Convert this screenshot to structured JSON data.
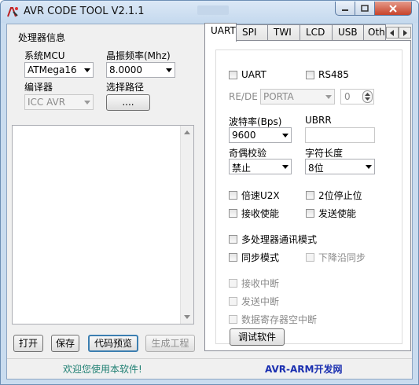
{
  "window": {
    "title": "AVR CODE TOOL V2.1.1"
  },
  "left": {
    "group_title": "处理器信息",
    "mcu": {
      "label": "系统MCU",
      "value": "ATMega16"
    },
    "freq": {
      "label": "晶振频率(Mhz)",
      "value": "8.0000"
    },
    "compiler": {
      "label": "编译器",
      "value": "ICC AVR"
    },
    "path": {
      "label": "选择路径",
      "button": "...."
    }
  },
  "buttons": {
    "open": "打开",
    "save": "保存",
    "preview": "代码预览",
    "generate": "生成工程"
  },
  "tabs": [
    "UART",
    "SPI",
    "TWI",
    "LCD",
    "USB",
    "Othe"
  ],
  "uart": {
    "uart_check": "UART",
    "rs485_check": "RS485",
    "rede_label": "RE/DE",
    "port_value": "PORTA",
    "pin_value": "0",
    "baud_label": "波特率(Bps)",
    "baud_value": "9600",
    "ubrr_label": "UBRR",
    "parity_label": "奇偶校验",
    "parity_value": "禁止",
    "charlen_label": "字符长度",
    "charlen_value": "8位",
    "u2x": "倍速U2X",
    "stop2": "2位停止位",
    "rx_enable": "接收使能",
    "tx_enable": "发送使能",
    "multiproc": "多处理器通讯模式",
    "sync_mode": "同步模式",
    "falling_sync": "下降沿同步",
    "rx_int": "接收中断",
    "tx_int": "发送中断",
    "udre_int": "数据寄存器空中断",
    "debug_button": "调试软件"
  },
  "status": {
    "welcome": "欢迎您使用本软件!",
    "brand": "AVR-ARM开发网",
    "welcome_color": "#1e7f72",
    "brand_color": "#1a2fb0"
  }
}
